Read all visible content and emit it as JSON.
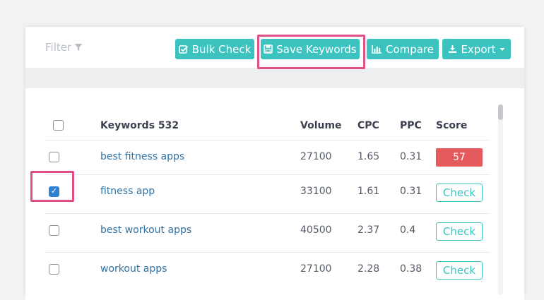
{
  "toolbar": {
    "filter_label": "Filter",
    "filter_icon": "funnel-icon",
    "bulk_check_label": "Bulk Check",
    "bulk_check_icon": "checkbox-icon",
    "save_keywords_label": "Save Keywords",
    "save_icon": "floppy-disk-icon",
    "compare_label": "Compare",
    "compare_icon": "bar-chart-icon",
    "export_label": "Export",
    "export_icon": "download-icon",
    "export_caret_icon": "caret-down-icon"
  },
  "table": {
    "headers": {
      "keywords": "Keywords 532",
      "volume": "Volume",
      "cpc": "CPC",
      "ppc": "PPC",
      "score": "Score"
    },
    "rows": [
      {
        "keyword": "best fitness apps",
        "volume": "27100",
        "cpc": "1.65",
        "ppc": "0.31",
        "score": "57",
        "checked": false
      },
      {
        "keyword": "fitness app",
        "volume": "33100",
        "cpc": "1.61",
        "ppc": "0.31",
        "score": "Check",
        "checked": true
      },
      {
        "keyword": "best workout apps",
        "volume": "40500",
        "cpc": "2.37",
        "ppc": "0.4",
        "score": "Check",
        "checked": false
      },
      {
        "keyword": "workout apps",
        "volume": "27100",
        "cpc": "2.28",
        "ppc": "0.38",
        "score": "Check",
        "checked": false
      }
    ]
  },
  "colors": {
    "accent": "#3cc3c0",
    "highlight": "#e04f86",
    "score_bad": "#e55b5d",
    "link": "#2f72a3",
    "checkbox_checked": "#2e82d6"
  }
}
